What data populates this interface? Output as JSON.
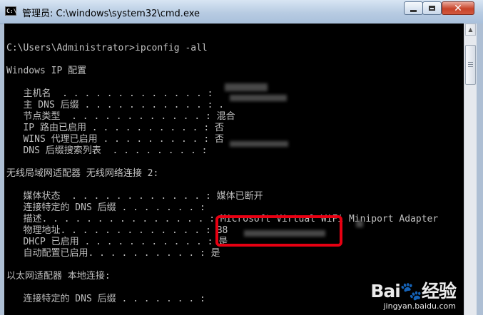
{
  "window": {
    "title": "管理员: C:\\windows\\system32\\cmd.exe",
    "icon": "cmd-icon",
    "icon_text": "C:\\",
    "buttons": {
      "minimize": "minimize-icon",
      "maximize": "maximize-icon",
      "close": "✕"
    }
  },
  "console": {
    "background": "#000000",
    "text_color": "#c0c0c0",
    "lines": [
      "",
      "C:\\Users\\Administrator>ipconfig -all",
      "",
      "Windows IP 配置",
      "",
      "   主机名  . . . . . . . . . . . . . :",
      "   主 DNS 后缀 . . . . . . . . . . . : .",
      "   节点类型  . . . . . . . . . . . . : 混合",
      "   IP 路由已启用 . . . . . . . . . . : 否",
      "   WINS 代理已启用 . . . . . . . . . : 否",
      "   DNS 后缀搜索列表  . . . . . . . . :",
      "",
      "无线局域网适配器 无线网络连接 2:",
      "",
      "   媒体状态  . . . . . . . . . . . . : 媒体已断开",
      "   连接特定的 DNS 后缀 . . . . . . . :",
      "   描述. . . . . . . . . . . . . . . : Microsoft Virtual WiFi Miniport Adapter",
      "   物理地址. . . . . . . . . . . . . : B8",
      "   DHCP 已启用 . . . . . . . . . . . : 是",
      "   自动配置已启用. . . . . . . . . . : 是",
      "",
      "以太网适配器 本地连接:",
      "",
      "   连接特定的 DNS 后缀 . . . . . . . :"
    ]
  },
  "watermark": {
    "logo": "Bai🐾经验",
    "url": "jingyan.baidu.com"
  },
  "colors": {
    "highlight_border": "#e60012",
    "titlebar": "#b7cbe2"
  }
}
